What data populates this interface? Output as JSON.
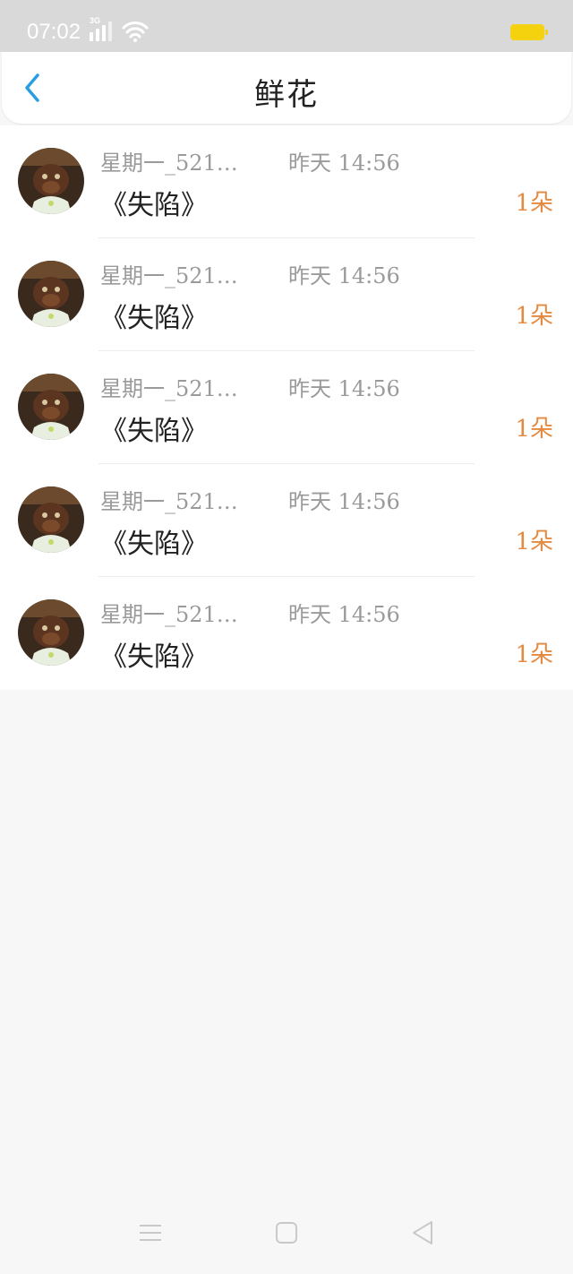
{
  "status_bar": {
    "time": "07:02",
    "signal_label": "3G",
    "signal_icon": "cellular-signal-icon",
    "wifi_icon": "wifi-icon",
    "battery_icon": "battery-icon",
    "battery_color": "#f5d20e"
  },
  "header": {
    "title": "鲜花",
    "back_icon": "chevron-left-icon",
    "accent_color": "#2a9ee0"
  },
  "list": {
    "items": [
      {
        "user": "星期一_521…",
        "time": "昨天  14:56",
        "book": "《失陷》",
        "count": "1朵"
      },
      {
        "user": "星期一_521…",
        "time": "昨天  14:56",
        "book": "《失陷》",
        "count": "1朵"
      },
      {
        "user": "星期一_521…",
        "time": "昨天  14:56",
        "book": "《失陷》",
        "count": "1朵"
      },
      {
        "user": "星期一_521…",
        "time": "昨天  14:56",
        "book": "《失陷》",
        "count": "1朵"
      },
      {
        "user": "星期一_521…",
        "time": "昨天  14:56",
        "book": "《失陷》",
        "count": "1朵"
      }
    ],
    "count_color": "#e5893e"
  },
  "system_nav": {
    "menu_icon": "menu-icon",
    "home_icon": "home-square-icon",
    "back_icon": "back-triangle-icon"
  }
}
